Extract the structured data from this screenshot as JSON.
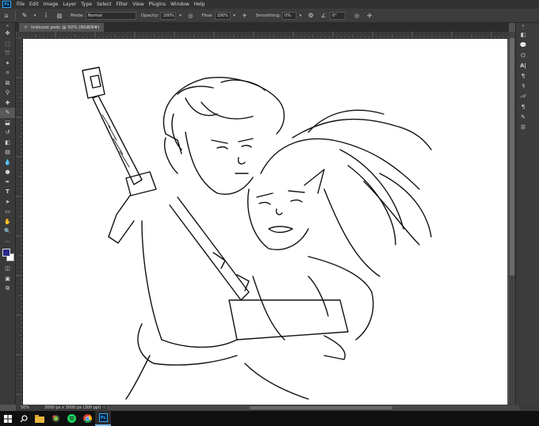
{
  "app": {
    "logo_text": "Ps",
    "menu": [
      "File",
      "Edit",
      "Image",
      "Layer",
      "Type",
      "Select",
      "Filter",
      "View",
      "Plugins",
      "Window",
      "Help"
    ]
  },
  "options": {
    "brush_size": "5",
    "mode_label": "Mode:",
    "mode_value": "Normal",
    "opacity_label": "Opacity:",
    "opacity_value": "100%",
    "flow_label": "Flow:",
    "flow_value": "100%",
    "smoothing_label": "Smoothing:",
    "smoothing_value": "0%",
    "angle_value": "0°"
  },
  "document": {
    "tab_title": "linkicest.psdc @ 50% (RGB/8#)",
    "close_glyph": "×"
  },
  "status": {
    "zoom": "50%",
    "doc_info": "3000 px x 3000 px (300 ppi)"
  },
  "colors": {
    "foreground": "#2a2a8c",
    "background": "#ffffff",
    "accent": "#31a8ff"
  }
}
